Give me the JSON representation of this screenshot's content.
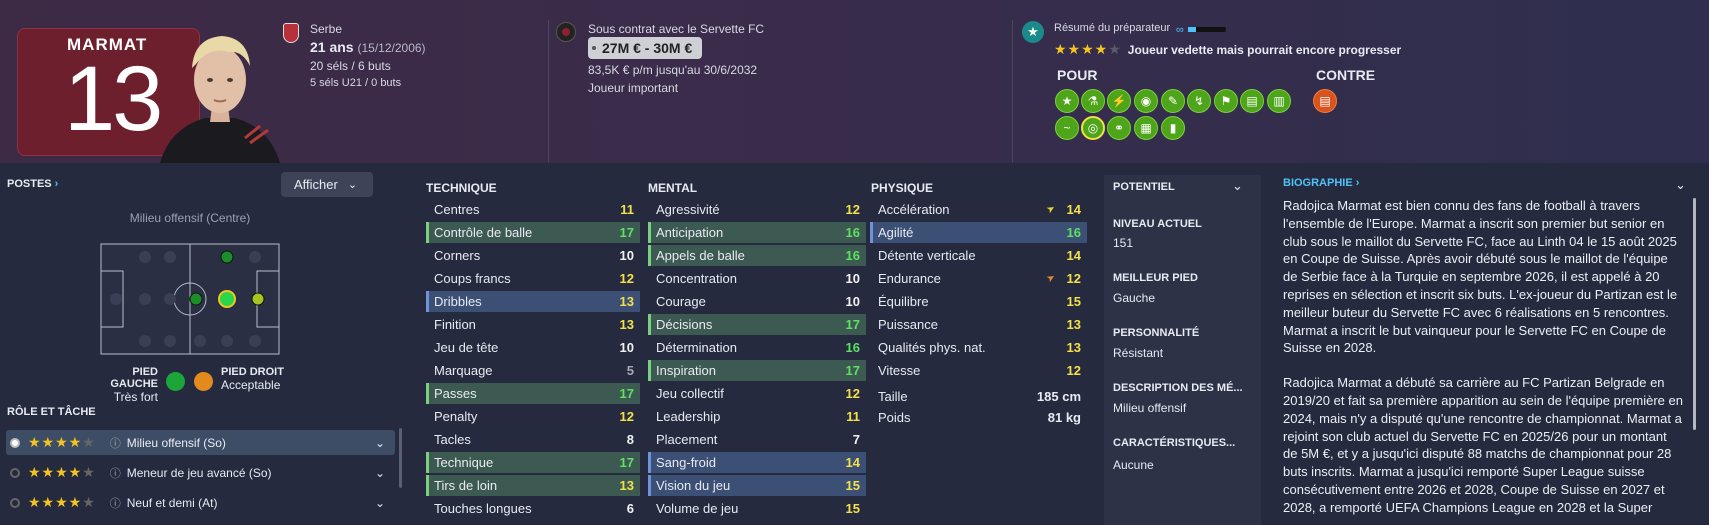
{
  "player": {
    "name": "MARMAT",
    "number": "13"
  },
  "bio_info": {
    "nationality": "Serbe",
    "age": "21 ans",
    "dob": "(15/12/2006)",
    "caps": "20 séls / 6 buts",
    "u21": "5 séls U21 / 0 buts"
  },
  "contract": {
    "club_text": "Sous contrat avec le Servette FC",
    "value": "27M € - 30M €",
    "wage": "83,5K € p/m jusqu'au 30/6/2032",
    "status": "Joueur important"
  },
  "coach": {
    "title": "Résumé du préparateur",
    "stars": 4,
    "verdict": "Joueur vedette mais pourrait encore progresser",
    "pour_label": "POUR",
    "contre_label": "CONTRE"
  },
  "left": {
    "postes_title": "POSTES",
    "afficher_label": "Afficher",
    "position_label": "Milieu offensif (Centre)",
    "foot_left_title": "PIED GAUCHE",
    "foot_left_value": "Très fort",
    "foot_right_title": "PIED DROIT",
    "foot_right_value": "Acceptable",
    "role_title": "RÔLE ET TÂCHE",
    "roles": [
      {
        "label": "Milieu offensif (So)",
        "stars": 4
      },
      {
        "label": "Meneur de jeu avancé (So)",
        "stars": 4
      },
      {
        "label": "Neuf et demi (At)",
        "stars": 4
      }
    ]
  },
  "attributes": {
    "technique_title": "TECHNIQUE",
    "mental_title": "MENTAL",
    "physique_title": "PHYSIQUE",
    "technique": [
      {
        "label": "Centres",
        "value": "11"
      },
      {
        "label": "Contrôle de balle",
        "value": "17"
      },
      {
        "label": "Corners",
        "value": "10"
      },
      {
        "label": "Coups francs",
        "value": "12"
      },
      {
        "label": "Dribbles",
        "value": "13"
      },
      {
        "label": "Finition",
        "value": "13"
      },
      {
        "label": "Jeu de tête",
        "value": "10"
      },
      {
        "label": "Marquage",
        "value": "5"
      },
      {
        "label": "Passes",
        "value": "17"
      },
      {
        "label": "Penalty",
        "value": "12"
      },
      {
        "label": "Tacles",
        "value": "8"
      },
      {
        "label": "Technique",
        "value": "17"
      },
      {
        "label": "Tirs de loin",
        "value": "13"
      },
      {
        "label": "Touches longues",
        "value": "6"
      }
    ],
    "mental": [
      {
        "label": "Agressivité",
        "value": "12"
      },
      {
        "label": "Anticipation",
        "value": "16"
      },
      {
        "label": "Appels de balle",
        "value": "16"
      },
      {
        "label": "Concentration",
        "value": "10"
      },
      {
        "label": "Courage",
        "value": "10"
      },
      {
        "label": "Décisions",
        "value": "17"
      },
      {
        "label": "Détermination",
        "value": "16"
      },
      {
        "label": "Inspiration",
        "value": "17"
      },
      {
        "label": "Jeu collectif",
        "value": "12"
      },
      {
        "label": "Leadership",
        "value": "11"
      },
      {
        "label": "Placement",
        "value": "7"
      },
      {
        "label": "Sang-froid",
        "value": "14"
      },
      {
        "label": "Vision du jeu",
        "value": "15"
      },
      {
        "label": "Volume de jeu",
        "value": "15"
      }
    ],
    "physique": [
      {
        "label": "Accélération",
        "value": "14"
      },
      {
        "label": "Agilité",
        "value": "16"
      },
      {
        "label": "Détente verticale",
        "value": "14"
      },
      {
        "label": "Endurance",
        "value": "12"
      },
      {
        "label": "Équilibre",
        "value": "15"
      },
      {
        "label": "Puissance",
        "value": "13"
      },
      {
        "label": "Qualités phys. nat.",
        "value": "13"
      },
      {
        "label": "Vitesse",
        "value": "12"
      }
    ],
    "height_label": "Taille",
    "height_value": "185 cm",
    "weight_label": "Poids",
    "weight_value": "81 kg"
  },
  "info": {
    "potentiel_title": "POTENTIEL",
    "niveau_title": "NIVEAU ACTUEL",
    "niveau_value": "151",
    "pied_title": "MEILLEUR PIED",
    "pied_value": "Gauche",
    "perso_title": "PERSONNALITÉ",
    "perso_value": "Résistant",
    "desc_title": "DESCRIPTION DES MÉ...",
    "desc_value": "Milieu offensif",
    "carac_title": "CARACTÉRISTIQUES...",
    "carac_value": "Aucune"
  },
  "biography": {
    "title": "BIOGRAPHIE",
    "p1": "Radojica Marmat est bien connu des fans de football à travers l'ensemble de l'Europe. Marmat a inscrit son premier but senior en club sous le maillot du Servette FC, face au Linth 04 le 15 août 2025 en Coupe de Suisse. Après avoir débuté sous le maillot de l'équipe de Serbie face à la Turquie en septembre 2026, il est appelé à 20 reprises en sélection et inscrit six buts. L'ex-joueur du Partizan est le meilleur buteur du Servette FC avec 6 réalisations en 5 rencontres. Marmat a inscrit le but vainqueur pour le Servette FC en Coupe de Suisse en 2028.",
    "p2": "Radojica Marmat a débuté sa carrière au FC Partizan Belgrade en 2019/20 et fait sa première apparition au sein de l'équipe première en 2024, mais n'y a disputé qu'une rencontre de championnat. Marmat a rejoint son club actuel du Servette FC en 2025/26 pour un montant de 5M €, et y a jusqu'ici disputé 88 matchs de championnat pour 28 buts inscrits. Marmat a jusqu'ici remporté Super League suisse consécutivement entre 2026 et 2028, Coupe de Suisse en 2027 et 2028, a remporté UEFA Champions League en 2028 et la Super"
  },
  "colors": {
    "accent": "#4fc3f7",
    "green": "#5ee063",
    "yellow": "#f4e04a",
    "trait_green": "#4fa51a",
    "trait_red": "#d9531e"
  }
}
